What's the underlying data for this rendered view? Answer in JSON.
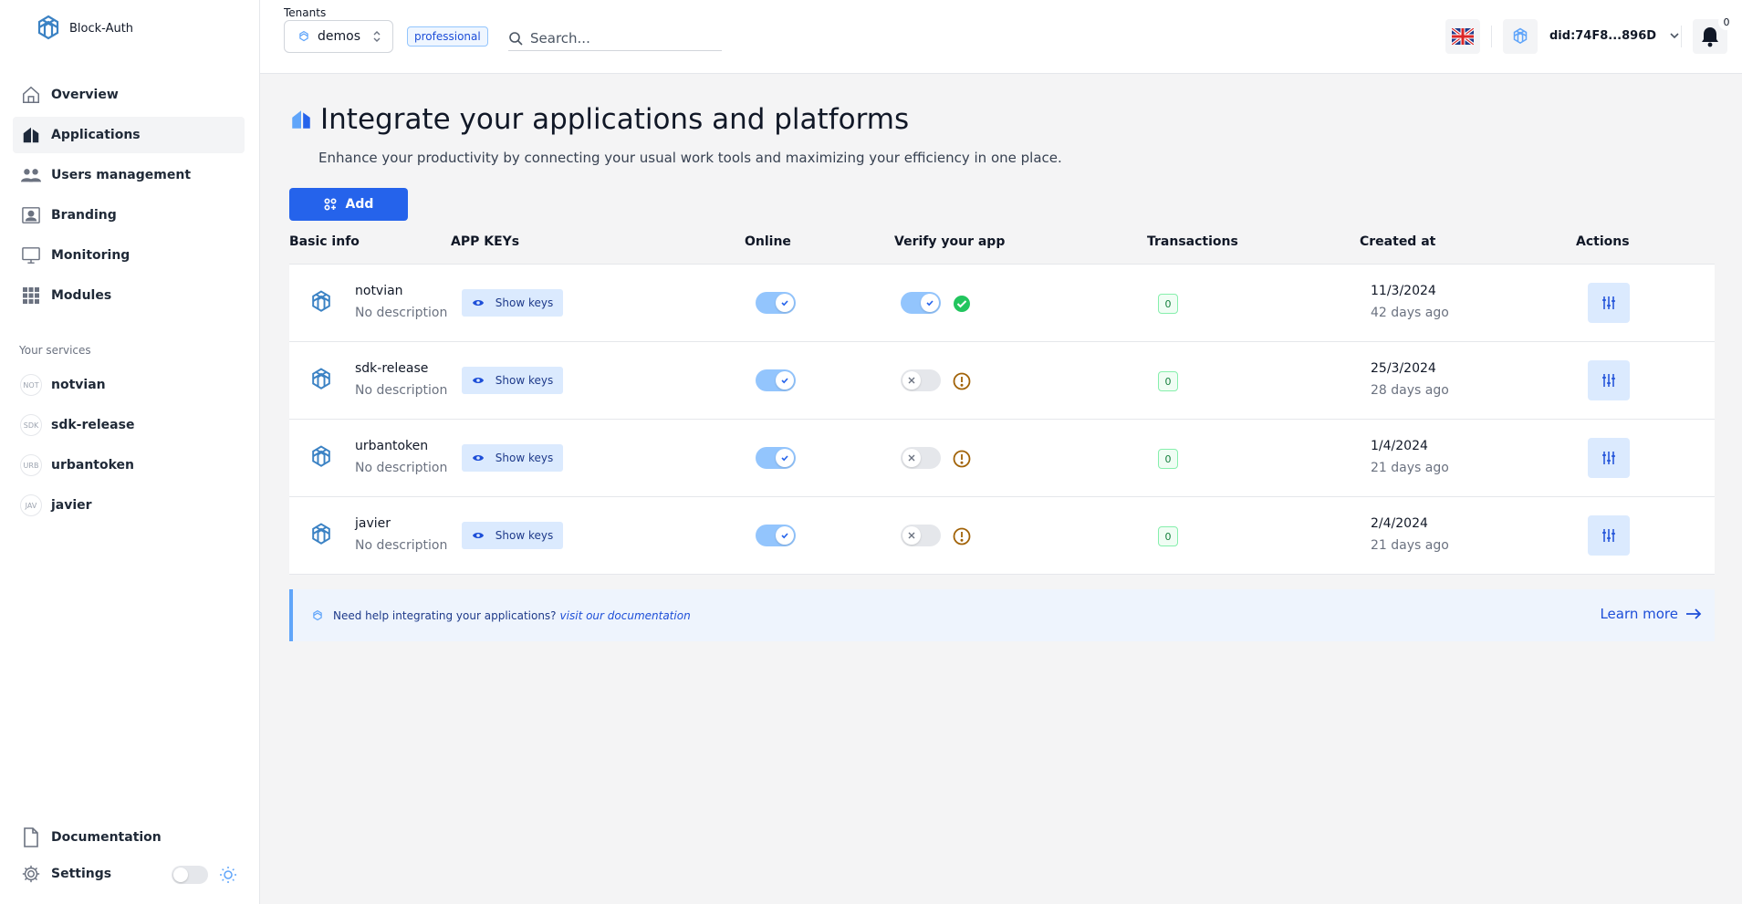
{
  "brand": {
    "name": "Block-Auth"
  },
  "sidebar": {
    "items": [
      {
        "label": "Overview",
        "icon": "home-icon"
      },
      {
        "label": "Applications",
        "icon": "applications-icon"
      },
      {
        "label": "Users management",
        "icon": "users-icon"
      },
      {
        "label": "Branding",
        "icon": "branding-icon"
      },
      {
        "label": "Monitoring",
        "icon": "monitor-icon"
      },
      {
        "label": "Modules",
        "icon": "modules-icon"
      }
    ],
    "active": "Applications",
    "services_title": "Your services",
    "services": [
      {
        "abbr": "NOT",
        "label": "notvian"
      },
      {
        "abbr": "SDK",
        "label": "sdk-release"
      },
      {
        "abbr": "URB",
        "label": "urbantoken"
      },
      {
        "abbr": "JAV",
        "label": "javier"
      }
    ],
    "bottom": [
      {
        "label": "Documentation",
        "icon": "document-icon"
      },
      {
        "label": "Settings",
        "icon": "gear-icon"
      }
    ]
  },
  "header": {
    "tenants_label": "Tenants",
    "tenant_value": "demos",
    "plan_badge": "professional",
    "search_placeholder": "Search...",
    "user_did": "did:74F8...896D",
    "notification_count": "0"
  },
  "main": {
    "title": "Integrate your applications and platforms",
    "subtitle": "Enhance your productivity by connecting your usual work tools and maximizing your efficiency in one place.",
    "add_label": "Add"
  },
  "table": {
    "headers": {
      "basic_info": "Basic info",
      "app_keys": "APP KEYs",
      "online": "Online",
      "verify": "Verify your app",
      "transactions": "Transactions",
      "created_at": "Created at",
      "actions": "Actions"
    },
    "show_keys_label": "Show keys",
    "rows": [
      {
        "name": "notvian",
        "description": "No description",
        "online": true,
        "verified": true,
        "transactions": "0",
        "created_date": "11/3/2024",
        "created_ago": "42 days ago"
      },
      {
        "name": "sdk-release",
        "description": "No description",
        "online": true,
        "verified": false,
        "transactions": "0",
        "created_date": "25/3/2024",
        "created_ago": "28 days ago"
      },
      {
        "name": "urbantoken",
        "description": "No description",
        "online": true,
        "verified": false,
        "transactions": "0",
        "created_date": "1/4/2024",
        "created_ago": "21 days ago"
      },
      {
        "name": "javier",
        "description": "No description",
        "online": true,
        "verified": false,
        "transactions": "0",
        "created_date": "2/4/2024",
        "created_ago": "21 days ago"
      }
    ]
  },
  "help": {
    "text": "Need help integrating your applications?",
    "link": "visit our documentation",
    "learn_more": "Learn more"
  },
  "colors": {
    "primary": "#2563eb",
    "toggle_on": "#93c5fd",
    "verified": "#22c55e",
    "warning": "#a16207"
  }
}
